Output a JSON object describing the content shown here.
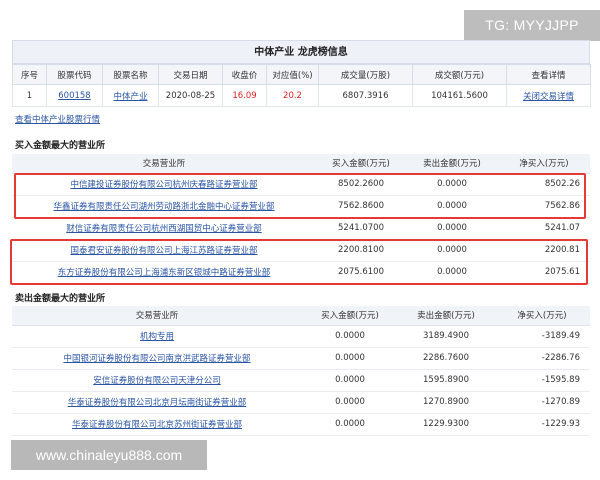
{
  "watermarks": {
    "top": "TG: MYYJJPP",
    "bottom": "www.chinaleyu888.com"
  },
  "panel": {
    "title": "中体产业 龙虎榜信息",
    "headers": [
      "序号",
      "股票代码",
      "股票名称",
      "交易日期",
      "收盘价",
      "对应值(%)",
      "成交量(万股)",
      "成交额(万元)",
      "查看详情"
    ],
    "row": {
      "index": "1",
      "code": "600158",
      "name": "中体产业",
      "date": "2020-08-25",
      "close": "16.09",
      "value": "20.2",
      "volume": "6807.3916",
      "amount": "104161.5600",
      "detail": "关闭交易详情"
    }
  },
  "view_link": "查看中体产业股票行情",
  "buy": {
    "title": "买入金额最大的营业所",
    "headers": [
      "交易营业所",
      "买入金额(万元)",
      "卖出金额(万元)",
      "净买入(万元)"
    ],
    "rows": [
      {
        "name": "中信建投证券股份有限公司杭州庆春路证券营业部",
        "buy": "8502.2600",
        "sell": "0.0000",
        "net": "8502.26"
      },
      {
        "name": "华鑫证券有限责任公司湖州劳动路浙北金融中心证券营业部",
        "buy": "7562.8600",
        "sell": "0.0000",
        "net": "7562.86"
      },
      {
        "name": "财信证券有限责任公司杭州西湖国贸中心证券营业部",
        "buy": "5241.0700",
        "sell": "0.0000",
        "net": "5241.07"
      },
      {
        "name": "国泰君安证券股份有限公司上海江苏路证券营业部",
        "buy": "2200.8100",
        "sell": "0.0000",
        "net": "2200.81"
      },
      {
        "name": "东方证券股份有限公司上海浦东新区银城中路证券营业部",
        "buy": "2075.6100",
        "sell": "0.0000",
        "net": "2075.61"
      }
    ]
  },
  "sell": {
    "title": "卖出金额最大的营业所",
    "headers": [
      "交易营业所",
      "买入金额(万元)",
      "卖出金额(万元)",
      "净买入(万元)"
    ],
    "rows": [
      {
        "name": "机构专用",
        "buy": "0.0000",
        "sell": "3189.4900",
        "net": "-3189.49"
      },
      {
        "name": "中国银河证券股份有限公司南京洪武路证券营业部",
        "buy": "0.0000",
        "sell": "2286.7600",
        "net": "-2286.76"
      },
      {
        "name": "安信证券股份有限公司天津分公司",
        "buy": "0.0000",
        "sell": "1595.8900",
        "net": "-1595.89"
      },
      {
        "name": "华泰证券股份有限公司北京月坛南街证券营业部",
        "buy": "0.0000",
        "sell": "1270.8900",
        "net": "-1270.89"
      },
      {
        "name": "华泰证券股份有限公司北京苏州街证券营业部",
        "buy": "0.0000",
        "sell": "1229.9300",
        "net": "-1229.93"
      }
    ]
  }
}
